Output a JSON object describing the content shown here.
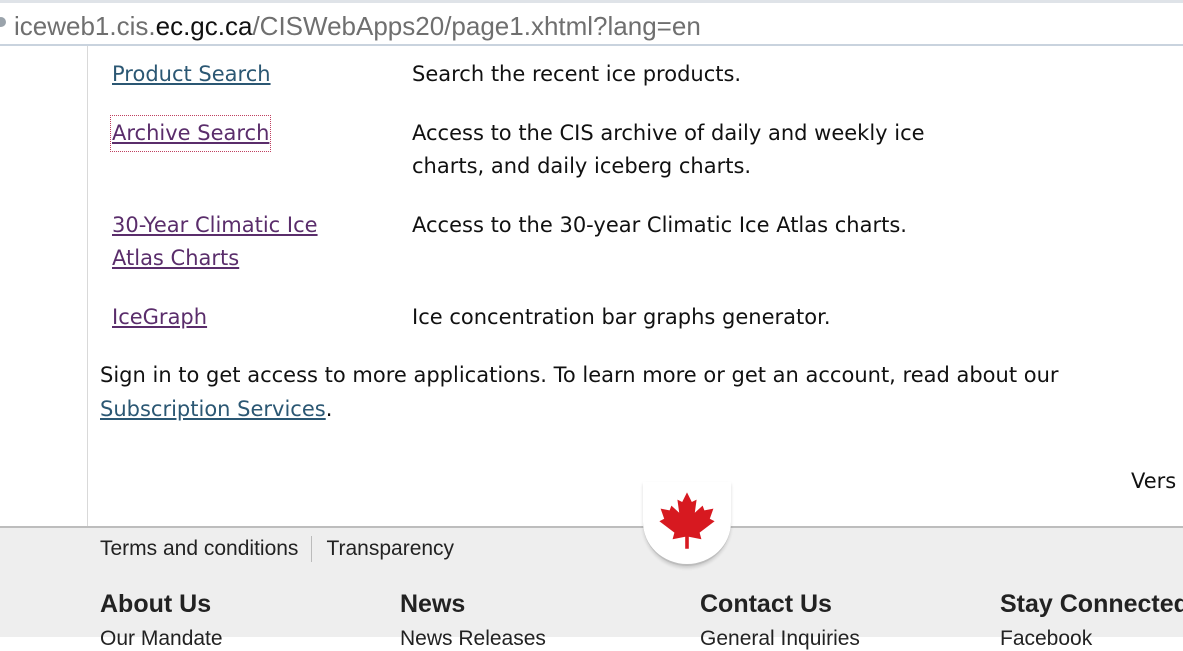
{
  "browser": {
    "url_prefix": "iceweb1.cis.",
    "url_domain": "ec.gc.ca",
    "url_path": "/CISWebApps20/page1.xhtml?lang=en"
  },
  "apps": [
    {
      "link": "Product Search",
      "desc": "Search the recent ice products."
    },
    {
      "link": "Archive Search",
      "desc": "Access to the CIS archive of daily and weekly ice charts, and daily iceberg charts."
    },
    {
      "link": "30-Year Climatic Ice Atlas Charts",
      "desc": "Access to the 30-year Climatic Ice Atlas charts."
    },
    {
      "link": "IceGraph",
      "desc": "Ice concentration bar graphs generator."
    }
  ],
  "signin": {
    "text": "Sign in to get access to more applications. To learn more or get an account, read about our ",
    "link": "Subscription Services",
    "end": "."
  },
  "version_text": "Vers",
  "footer": {
    "terms": "Terms and conditions",
    "transparency": "Transparency",
    "headings": [
      "About Us",
      "News",
      "Contact Us",
      "Stay Connected"
    ],
    "subitems": [
      "Our Mandate",
      "News Releases",
      "General Inquiries",
      "Facebook"
    ]
  },
  "colors": {
    "link": "#2b5773",
    "visited_link": "#5a2d6b",
    "maple_leaf": "#d71920"
  }
}
